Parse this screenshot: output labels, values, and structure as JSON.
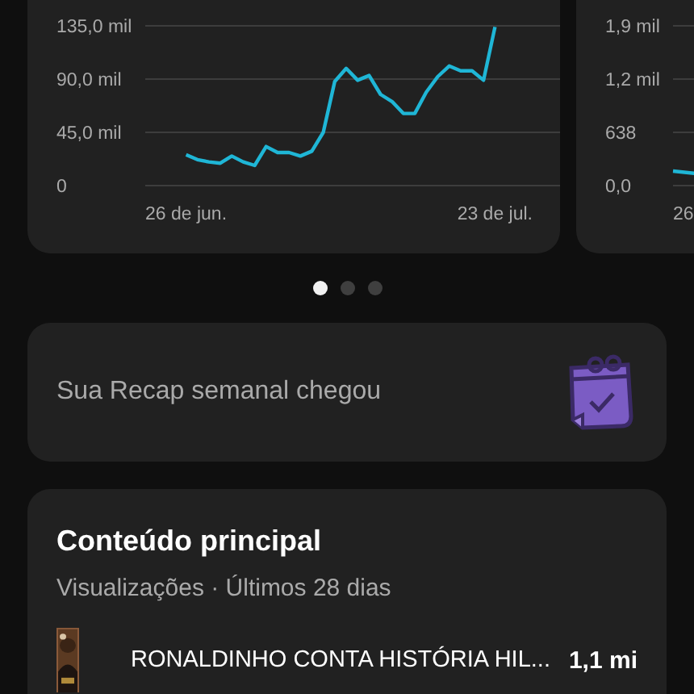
{
  "charts": [
    {
      "chart_data": {
        "type": "line",
        "categories": [
          "26 de jun.",
          null,
          null,
          null,
          null,
          null,
          null,
          null,
          null,
          null,
          null,
          null,
          null,
          null,
          null,
          null,
          null,
          null,
          null,
          null,
          null,
          null,
          null,
          null,
          null,
          null,
          null,
          "23 de jul."
        ],
        "ylim": [
          0,
          135
        ],
        "yticks": [
          {
            "value": 0,
            "label": "0"
          },
          {
            "value": 45,
            "label": "45,0 mil"
          },
          {
            "value": 90,
            "label": "90,0 mil"
          },
          {
            "value": 135,
            "label": "135,0 mil"
          }
        ],
        "series": [
          {
            "color": "#1fb6d6",
            "values": [
              26,
              22,
              20,
              19,
              25,
              20,
              17,
              33,
              28,
              28,
              25,
              29,
              45,
              88,
              99,
              89,
              93,
              77,
              71,
              61,
              61,
              79,
              92,
              101,
              97,
              97,
              89,
              134
            ]
          }
        ]
      }
    },
    {
      "y_labels": [
        "1,9 mil",
        "1,2 mil",
        "638",
        "0,0"
      ],
      "x_labels": [
        "26"
      ]
    }
  ],
  "pager": [
    {
      "selected": true
    },
    {
      "selected": false
    },
    {
      "selected": false
    }
  ],
  "recap": {
    "text": "Sua Recap semanal chegou"
  },
  "top_content": {
    "title": "Conteúdo principal",
    "subtitle": "Visualizações · Últimos 28 dias",
    "items": [
      {
        "kind": "picture",
        "title": "RONALDINHO CONTA HISTÓRIA HIL...",
        "views": "1,1 mi"
      }
    ]
  }
}
